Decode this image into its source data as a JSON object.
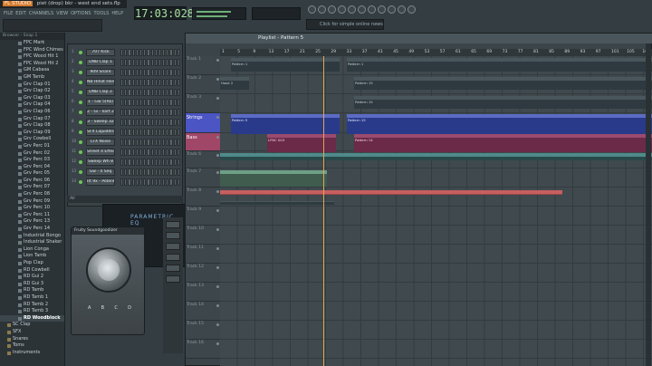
{
  "window": {
    "app_label": "FL STUDIO",
    "title": "piet (drop) bkr - west end sets.flp",
    "menu": [
      "FILE",
      "EDIT",
      "CHANNELS",
      "VIEW",
      "OPTIONS",
      "TOOLS",
      "HELP"
    ],
    "time_display": "17:03:028",
    "hint_text": "Click for simple online news"
  },
  "browser": {
    "header": "Browser - Snap 1",
    "items": [
      {
        "label": "FPC Mark",
        "type": "file"
      },
      {
        "label": "FPC Wind Chimes",
        "type": "file"
      },
      {
        "label": "FPC Wood Hit 1",
        "type": "file"
      },
      {
        "label": "FPC Wood Hit 2",
        "type": "file"
      },
      {
        "label": "GM Cabasa",
        "type": "file"
      },
      {
        "label": "GM Tamb",
        "type": "file"
      },
      {
        "label": "Grv Clap 01",
        "type": "file"
      },
      {
        "label": "Grv Clap 02",
        "type": "file"
      },
      {
        "label": "Grv Clap 03",
        "type": "file"
      },
      {
        "label": "Grv Clap 04",
        "type": "file"
      },
      {
        "label": "Grv Clap 06",
        "type": "file"
      },
      {
        "label": "Grv Clap 07",
        "type": "file"
      },
      {
        "label": "Grv Clap 08",
        "type": "file"
      },
      {
        "label": "Grv Clap 09",
        "type": "file"
      },
      {
        "label": "Grv Cowbell",
        "type": "file"
      },
      {
        "label": "Grv Perc 01",
        "type": "file"
      },
      {
        "label": "Grv Perc 02",
        "type": "file"
      },
      {
        "label": "Grv Perc 03",
        "type": "file"
      },
      {
        "label": "Grv Perc 04",
        "type": "file"
      },
      {
        "label": "Grv Perc 05",
        "type": "file"
      },
      {
        "label": "Grv Perc 06",
        "type": "file"
      },
      {
        "label": "Grv Perc 07",
        "type": "file"
      },
      {
        "label": "Grv Perc 08",
        "type": "file"
      },
      {
        "label": "Grv Perc 09",
        "type": "file"
      },
      {
        "label": "Grv Perc 10",
        "type": "file"
      },
      {
        "label": "Grv Perc 11",
        "type": "file"
      },
      {
        "label": "Grv Perc 13",
        "type": "file"
      },
      {
        "label": "Grv Perc 14",
        "type": "file"
      },
      {
        "label": "Industrial Bongo",
        "type": "file"
      },
      {
        "label": "Industrial Shaker",
        "type": "file"
      },
      {
        "label": "Lion Conga",
        "type": "file"
      },
      {
        "label": "Lion Tamb",
        "type": "file"
      },
      {
        "label": "Pop Clap",
        "type": "file"
      },
      {
        "label": "RD Cowbell",
        "type": "file"
      },
      {
        "label": "RD Gui 2",
        "type": "file"
      },
      {
        "label": "RD Gui 3",
        "type": "file"
      },
      {
        "label": "RD Tamb",
        "type": "file"
      },
      {
        "label": "RD Tamb 1",
        "type": "file"
      },
      {
        "label": "RD Tamb 2",
        "type": "file"
      },
      {
        "label": "RD Tamb 3",
        "type": "file"
      },
      {
        "label": "RD Woodblock",
        "type": "file",
        "selected": true
      },
      {
        "label": "SC Clap",
        "type": "folder"
      },
      {
        "label": "SFX",
        "type": "folder"
      },
      {
        "label": "Snares",
        "type": "folder"
      },
      {
        "label": "Toms",
        "type": "folder"
      },
      {
        "label": "Instruments",
        "type": "folder"
      }
    ]
  },
  "channel_rack": {
    "footer": "All",
    "channels": [
      {
        "num": "1",
        "name": "707 Kick"
      },
      {
        "num": "2",
        "name": "DNB Clap 1"
      },
      {
        "num": "3",
        "name": "909 Snare"
      },
      {
        "num": "4",
        "name": "NB Hihat Hold"
      },
      {
        "num": "5",
        "name": "DNB Clap 2"
      },
      {
        "num": "6",
        "name": "1 - Gw 5(Ro)"
      },
      {
        "num": "7",
        "name": "2 - Gi - kart 2"
      },
      {
        "num": "8",
        "name": "3 - Sweep 32"
      },
      {
        "num": "9",
        "name": "SFX Liquiddrop"
      },
      {
        "num": "10",
        "name": "LFX Noise"
      },
      {
        "num": "11",
        "name": "Street 4 Effect"
      },
      {
        "num": "12",
        "name": "Sweep Wh 8"
      },
      {
        "num": "13",
        "name": "Gw - 4 Seq"
      },
      {
        "num": "14",
        "name": "Rt 9x - Potent"
      }
    ]
  },
  "plugins": {
    "eq_label": "PARAMETRIC EQ",
    "comp_title": "Fruity Soundgoodizer",
    "comp_modes": [
      "A",
      "B",
      "C",
      "D"
    ]
  },
  "playlist": {
    "title": "Playlist - Pattern 5",
    "ruler": [
      "1",
      "5",
      "9",
      "13",
      "17",
      "21",
      "25",
      "29",
      "33",
      "37",
      "41",
      "45",
      "49",
      "53",
      "57",
      "61",
      "65",
      "69",
      "73",
      "77",
      "81",
      "85",
      "89",
      "93",
      "97",
      "101",
      "105",
      "109"
    ],
    "tracks": [
      {
        "label": "Track 1"
      },
      {
        "label": "Track 2"
      },
      {
        "label": "Track 3"
      },
      {
        "label": "Strings"
      },
      {
        "label": "Bass"
      },
      {
        "label": "Track 6"
      },
      {
        "label": "Track 7"
      },
      {
        "label": "Track 8"
      },
      {
        "label": "Track 9"
      },
      {
        "label": "Track 10"
      },
      {
        "label": "Track 11"
      },
      {
        "label": "Track 12"
      },
      {
        "label": "Track 13"
      },
      {
        "label": "Track 14"
      },
      {
        "label": "Track 15"
      },
      {
        "label": "Track 16"
      }
    ],
    "clips": {
      "pattern1": "Pattern 1",
      "pattern3": "Pattern 3",
      "pattern5": "Pattern 5",
      "pattern15": "Pattern 15",
      "pattern14": "Pattern 14",
      "hook": "Hook 2",
      "lfo": "LFNC 003"
    }
  },
  "colors": {
    "accent_orange": "#d47a2b",
    "strings": "#4b55c4",
    "bass": "#a04667",
    "led_green": "#6ec45a"
  }
}
